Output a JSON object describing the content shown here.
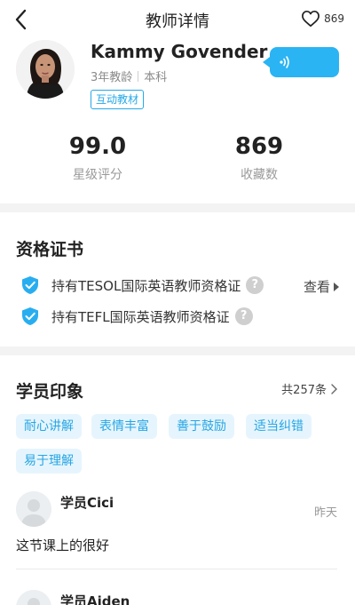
{
  "header": {
    "title": "教师详情",
    "favorite_count": "869"
  },
  "profile": {
    "name": "Kammy Govender",
    "years": "3年教龄",
    "degree": "本科",
    "tag": "互动教材"
  },
  "stats": [
    {
      "value": "99.0",
      "label": "星级评分"
    },
    {
      "value": "869",
      "label": "收藏数"
    }
  ],
  "certificates": {
    "title": "资格证书",
    "view_label": "查看",
    "items": [
      "持有TESOL国际英语教师资格证",
      "持有TEFL国际英语教师资格证"
    ]
  },
  "impressions": {
    "title": "学员印象",
    "total": "共257条",
    "chips": [
      "耐心讲解",
      "表情丰富",
      "善于鼓励",
      "适当纠错",
      "易于理解"
    ]
  },
  "reviews": [
    {
      "name": "学员Cici",
      "time": "昨天",
      "text": "这节课上的很好"
    },
    {
      "name": "学员Aiden",
      "time": "",
      "text": ""
    }
  ],
  "colors": {
    "accent": "#2ab4f3",
    "chip_bg": "#e6f5fd",
    "chip_text": "#27a6e4"
  }
}
